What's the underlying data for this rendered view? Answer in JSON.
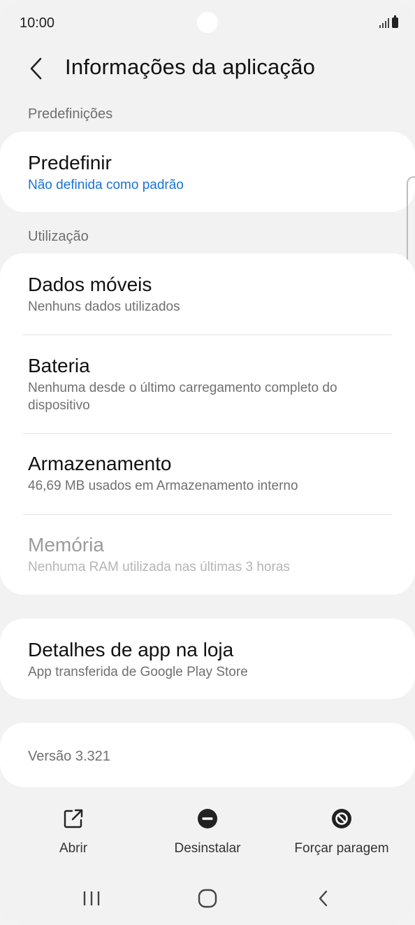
{
  "status_bar": {
    "time": "10:00"
  },
  "header": {
    "title": "Informações da aplicação"
  },
  "sections": {
    "defaults_label": "Predefinições",
    "usage_label": "Utilização"
  },
  "defaults_card": {
    "title": "Predefinir",
    "subtitle": "Não definida como padrão"
  },
  "usage_items": [
    {
      "title": "Dados móveis",
      "subtitle": "Nenhuns dados utilizados"
    },
    {
      "title": "Bateria",
      "subtitle": "Nenhuma desde o último carregamento completo do dispositivo"
    },
    {
      "title": "Armazenamento",
      "subtitle": "46,69 MB usados em Armazenamento interno"
    },
    {
      "title": "Memória",
      "subtitle": "Nenhuma RAM utilizada nas últimas 3 horas"
    }
  ],
  "store_card": {
    "title": "Detalhes de app na loja",
    "subtitle": "App transferida de Google Play Store"
  },
  "version": {
    "text": "Versão 3.321"
  },
  "actions": {
    "open": "Abrir",
    "uninstall": "Desinstalar",
    "force_stop": "Forçar paragem"
  },
  "colors": {
    "accent": "#1a73d6",
    "background": "#f2f2f2",
    "card": "#ffffff"
  }
}
